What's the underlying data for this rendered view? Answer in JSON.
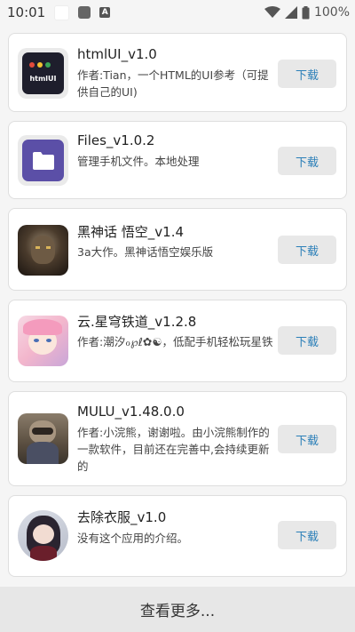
{
  "status": {
    "time": "10:01",
    "a_icon": "A",
    "battery": "100%",
    "icons": [
      "white-square-icon",
      "gray-square-icon",
      "a-badge-icon",
      "wifi-icon",
      "signal-icon",
      "battery-icon"
    ]
  },
  "apps": [
    {
      "title": "htmlUI_v1.0",
      "desc": "作者:Tian，一个HTML的UI参考（可提供自己的UI)",
      "button": "下载",
      "icon_text": "htmlUI"
    },
    {
      "title": "Files_v1.0.2",
      "desc": "管理手机文件。本地处理",
      "button": "下载"
    },
    {
      "title": "黑神话 悟空_v1.4",
      "desc": "3a大作。黑神话悟空娱乐版",
      "button": "下载"
    },
    {
      "title": "云.星穹铁道_v1.2.8",
      "desc": "作者:潮汐ℴ℘ℓ✿☯，低配手机轻松玩星铁",
      "button": "下载"
    },
    {
      "title": "MULU_v1.48.0.0",
      "desc": "作者:小浣熊，谢谢啦。由小浣熊制作的一款软件，目前还在完善中,会持续更新的",
      "button": "下载"
    },
    {
      "title": "去除衣服_v1.0",
      "desc": "没有这个应用的介绍。",
      "button": "下载"
    }
  ],
  "more": "查看更多...",
  "colors": {
    "button_text": "#2b7fb8",
    "button_bg": "#e8e8e8",
    "files_icon": "#5b4fa7"
  }
}
